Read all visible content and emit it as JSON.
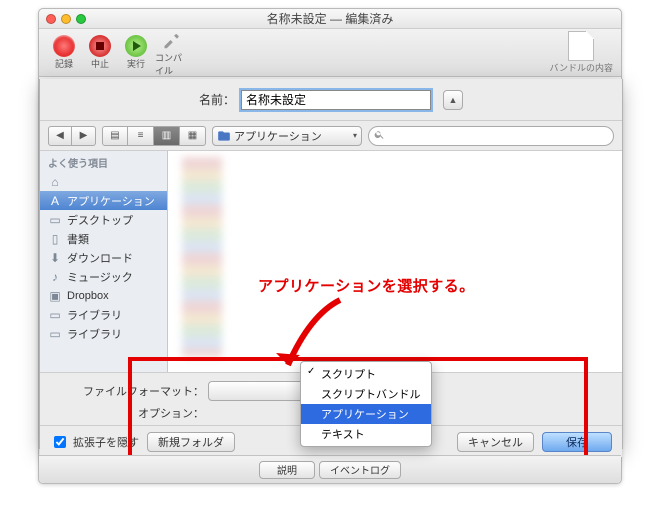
{
  "window": {
    "title": "名称未設定 — 編集済み"
  },
  "toolbar": {
    "record": "記録",
    "stop": "中止",
    "run": "実行",
    "compile": "コンパイル",
    "bundle": "バンドルの内容"
  },
  "sheet": {
    "name_label": "名前：",
    "name_value": "名称未設定",
    "location_label": "アプリケーション",
    "search_placeholder": "",
    "sidebar": {
      "header": "よく使う項目",
      "items": [
        {
          "icon": "user",
          "label": ""
        },
        {
          "icon": "app",
          "label": "アプリケーション",
          "selected": true
        },
        {
          "icon": "desktop",
          "label": "デスクトップ"
        },
        {
          "icon": "docs",
          "label": "書類"
        },
        {
          "icon": "download",
          "label": "ダウンロード"
        },
        {
          "icon": "music",
          "label": "ミュージック"
        },
        {
          "icon": "dropbox",
          "label": "Dropbox"
        },
        {
          "icon": "folder",
          "label": "ライブラリ"
        },
        {
          "icon": "folder",
          "label": "ライブラリ"
        }
      ]
    },
    "format_label": "ファイルフォーマット：",
    "options_label": "オプション：",
    "format_menu": {
      "items": [
        {
          "label": "スクリプト",
          "checked": true
        },
        {
          "label": "スクリプトバンドル"
        },
        {
          "label": "アプリケーション",
          "selected": true
        },
        {
          "label": "テキスト"
        }
      ]
    },
    "hide_ext_label": "拡張子を隠す",
    "new_folder": "新規フォルダ",
    "cancel": "キャンセル",
    "save": "保存"
  },
  "footer": {
    "desc": "説明",
    "log": "イベントログ"
  },
  "annotation": {
    "text": "アプリケーションを選択する。"
  }
}
